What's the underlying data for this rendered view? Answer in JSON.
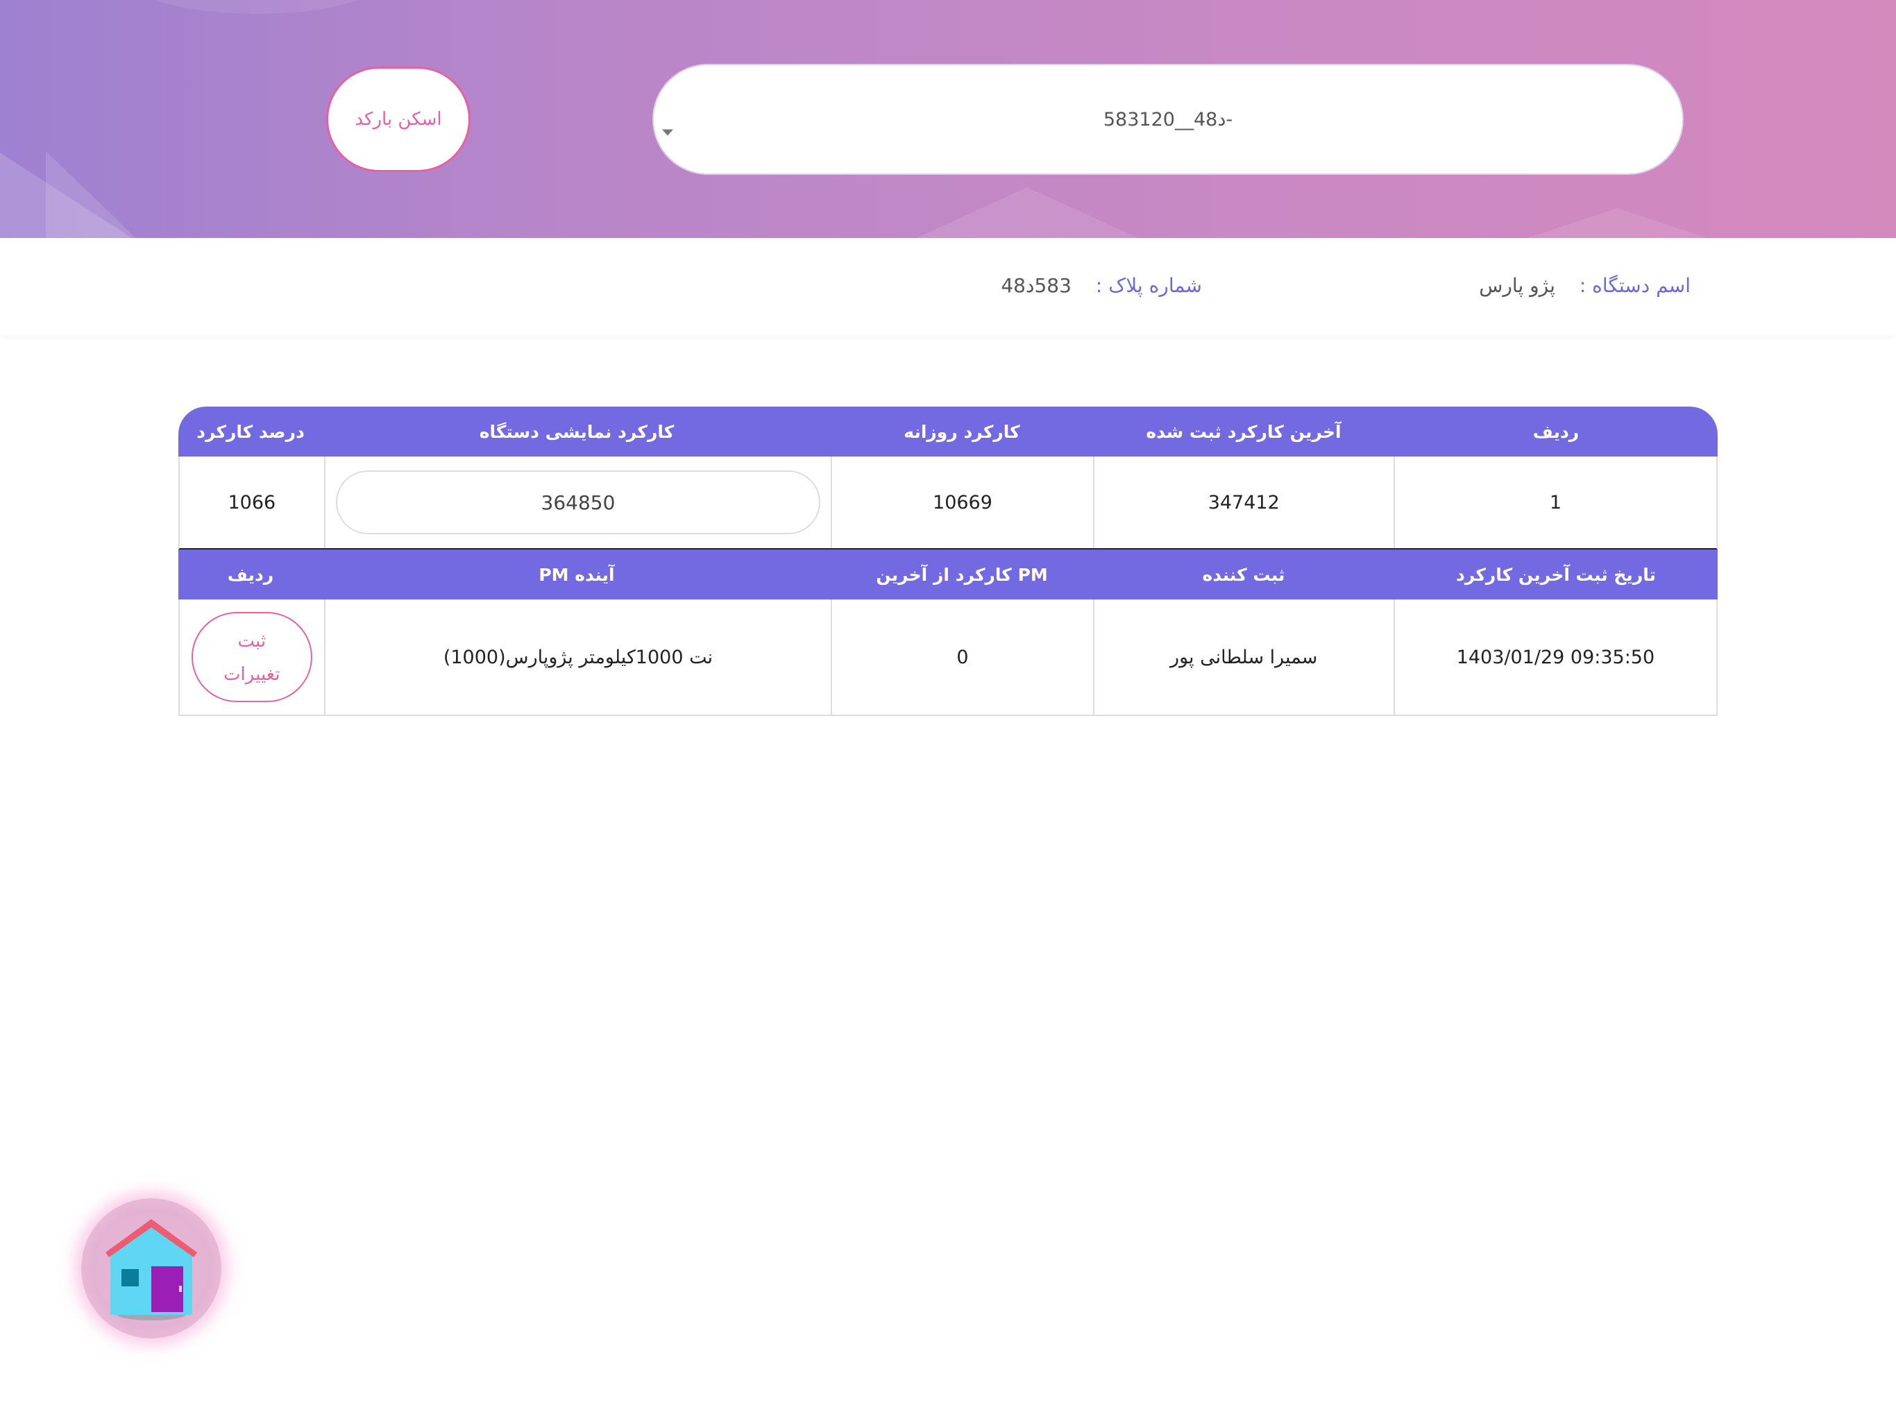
{
  "header": {
    "plate_select_value": "583د48__120-",
    "scan_button_label": "اسکن بارکد"
  },
  "device_info": {
    "name_label": "اسم دستگاه :",
    "name_value": "پژو پارس",
    "plate_label": "شماره پلاک :",
    "plate_value": "583د48"
  },
  "table": {
    "header1": {
      "radif": "ردیف",
      "last_recorded": "آخرین کارکرد ثبت شده",
      "daily": "کارکرد روزانه",
      "display": "کارکرد نمایشی دستگاه",
      "percent": "درصد کارکرد"
    },
    "row1": {
      "radif": "1",
      "last_recorded": "347412",
      "daily": "10669",
      "display": "364850",
      "percent": "1066"
    },
    "header2": {
      "date": "تاریخ ثبت آخرین کارکرد",
      "recorder": "ثبت کننده",
      "since_pm": "کارکرد از آخرین PM",
      "next_pm": "PM آینده",
      "radif": "ردیف"
    },
    "row2": {
      "date": "1403/01/29 09:35:50",
      "recorder": "سمیرا سلطانی پور",
      "since_pm": "0",
      "next_pm": "نت 1000کیلومتر پژوپارس(1000)",
      "save_line1": "ثبت",
      "save_line2": "تغییرات"
    }
  },
  "fab": {
    "icon": "home-icon"
  },
  "colors": {
    "accent_purple": "#736ae2",
    "accent_pink": "#e8609f",
    "label_blue": "#6a6ad6"
  }
}
